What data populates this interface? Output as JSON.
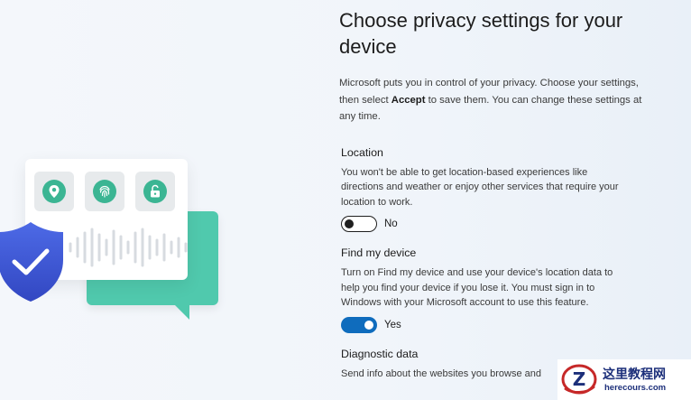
{
  "page": {
    "title": "Choose privacy settings for your device",
    "intro": {
      "before": "Microsoft puts you in control of your privacy. Choose your settings, then select ",
      "bold": "Accept",
      "after": " to save them. You can change these settings at any time."
    }
  },
  "settings": [
    {
      "title": "Location",
      "description": "You won't be able to get location-based experiences like directions and weather or enjoy other services that require your location to work.",
      "toggle_state": "off",
      "toggle_label": "No"
    },
    {
      "title": "Find my device",
      "description": "Turn on Find my device and use your device's location data to help you find your device if you lose it. You must sign in to Windows with your Microsoft account to use this feature.",
      "toggle_state": "on",
      "toggle_label": "Yes"
    },
    {
      "title": "Diagnostic data",
      "description": "Send info about the websites you browse and"
    }
  ],
  "illustration": {
    "tiles": [
      "location-pin-icon",
      "fingerprint-icon",
      "unlocked-padlock-icon"
    ],
    "shield": "shield-checkmark-icon",
    "colors": {
      "teal": "#50c9ad",
      "tile_icon": "#3bb593",
      "shield": "#3f5bd8",
      "toggle_on": "#0f6cbd"
    }
  },
  "watermark": {
    "logo_letter": "Z",
    "title": "这里教程网",
    "url": "herecours.com"
  }
}
